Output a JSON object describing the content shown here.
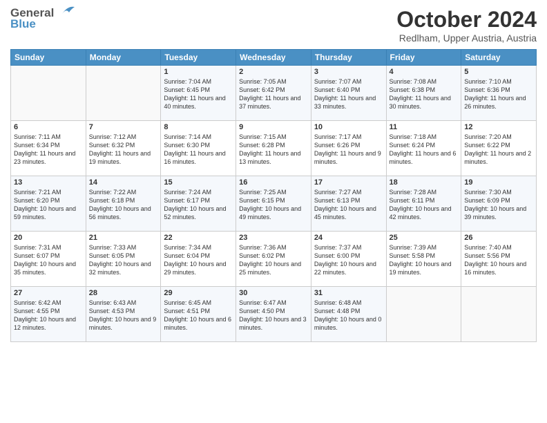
{
  "header": {
    "logo_line1": "General",
    "logo_line2": "Blue",
    "month": "October 2024",
    "location": "Redlham, Upper Austria, Austria"
  },
  "days_of_week": [
    "Sunday",
    "Monday",
    "Tuesday",
    "Wednesday",
    "Thursday",
    "Friday",
    "Saturday"
  ],
  "weeks": [
    [
      {
        "day": "",
        "content": ""
      },
      {
        "day": "",
        "content": ""
      },
      {
        "day": "1",
        "content": "Sunrise: 7:04 AM\nSunset: 6:45 PM\nDaylight: 11 hours and 40 minutes."
      },
      {
        "day": "2",
        "content": "Sunrise: 7:05 AM\nSunset: 6:42 PM\nDaylight: 11 hours and 37 minutes."
      },
      {
        "day": "3",
        "content": "Sunrise: 7:07 AM\nSunset: 6:40 PM\nDaylight: 11 hours and 33 minutes."
      },
      {
        "day": "4",
        "content": "Sunrise: 7:08 AM\nSunset: 6:38 PM\nDaylight: 11 hours and 30 minutes."
      },
      {
        "day": "5",
        "content": "Sunrise: 7:10 AM\nSunset: 6:36 PM\nDaylight: 11 hours and 26 minutes."
      }
    ],
    [
      {
        "day": "6",
        "content": "Sunrise: 7:11 AM\nSunset: 6:34 PM\nDaylight: 11 hours and 23 minutes."
      },
      {
        "day": "7",
        "content": "Sunrise: 7:12 AM\nSunset: 6:32 PM\nDaylight: 11 hours and 19 minutes."
      },
      {
        "day": "8",
        "content": "Sunrise: 7:14 AM\nSunset: 6:30 PM\nDaylight: 11 hours and 16 minutes."
      },
      {
        "day": "9",
        "content": "Sunrise: 7:15 AM\nSunset: 6:28 PM\nDaylight: 11 hours and 13 minutes."
      },
      {
        "day": "10",
        "content": "Sunrise: 7:17 AM\nSunset: 6:26 PM\nDaylight: 11 hours and 9 minutes."
      },
      {
        "day": "11",
        "content": "Sunrise: 7:18 AM\nSunset: 6:24 PM\nDaylight: 11 hours and 6 minutes."
      },
      {
        "day": "12",
        "content": "Sunrise: 7:20 AM\nSunset: 6:22 PM\nDaylight: 11 hours and 2 minutes."
      }
    ],
    [
      {
        "day": "13",
        "content": "Sunrise: 7:21 AM\nSunset: 6:20 PM\nDaylight: 10 hours and 59 minutes."
      },
      {
        "day": "14",
        "content": "Sunrise: 7:22 AM\nSunset: 6:18 PM\nDaylight: 10 hours and 56 minutes."
      },
      {
        "day": "15",
        "content": "Sunrise: 7:24 AM\nSunset: 6:17 PM\nDaylight: 10 hours and 52 minutes."
      },
      {
        "day": "16",
        "content": "Sunrise: 7:25 AM\nSunset: 6:15 PM\nDaylight: 10 hours and 49 minutes."
      },
      {
        "day": "17",
        "content": "Sunrise: 7:27 AM\nSunset: 6:13 PM\nDaylight: 10 hours and 45 minutes."
      },
      {
        "day": "18",
        "content": "Sunrise: 7:28 AM\nSunset: 6:11 PM\nDaylight: 10 hours and 42 minutes."
      },
      {
        "day": "19",
        "content": "Sunrise: 7:30 AM\nSunset: 6:09 PM\nDaylight: 10 hours and 39 minutes."
      }
    ],
    [
      {
        "day": "20",
        "content": "Sunrise: 7:31 AM\nSunset: 6:07 PM\nDaylight: 10 hours and 35 minutes."
      },
      {
        "day": "21",
        "content": "Sunrise: 7:33 AM\nSunset: 6:05 PM\nDaylight: 10 hours and 32 minutes."
      },
      {
        "day": "22",
        "content": "Sunrise: 7:34 AM\nSunset: 6:04 PM\nDaylight: 10 hours and 29 minutes."
      },
      {
        "day": "23",
        "content": "Sunrise: 7:36 AM\nSunset: 6:02 PM\nDaylight: 10 hours and 25 minutes."
      },
      {
        "day": "24",
        "content": "Sunrise: 7:37 AM\nSunset: 6:00 PM\nDaylight: 10 hours and 22 minutes."
      },
      {
        "day": "25",
        "content": "Sunrise: 7:39 AM\nSunset: 5:58 PM\nDaylight: 10 hours and 19 minutes."
      },
      {
        "day": "26",
        "content": "Sunrise: 7:40 AM\nSunset: 5:56 PM\nDaylight: 10 hours and 16 minutes."
      }
    ],
    [
      {
        "day": "27",
        "content": "Sunrise: 6:42 AM\nSunset: 4:55 PM\nDaylight: 10 hours and 12 minutes."
      },
      {
        "day": "28",
        "content": "Sunrise: 6:43 AM\nSunset: 4:53 PM\nDaylight: 10 hours and 9 minutes."
      },
      {
        "day": "29",
        "content": "Sunrise: 6:45 AM\nSunset: 4:51 PM\nDaylight: 10 hours and 6 minutes."
      },
      {
        "day": "30",
        "content": "Sunrise: 6:47 AM\nSunset: 4:50 PM\nDaylight: 10 hours and 3 minutes."
      },
      {
        "day": "31",
        "content": "Sunrise: 6:48 AM\nSunset: 4:48 PM\nDaylight: 10 hours and 0 minutes."
      },
      {
        "day": "",
        "content": ""
      },
      {
        "day": "",
        "content": ""
      }
    ]
  ]
}
